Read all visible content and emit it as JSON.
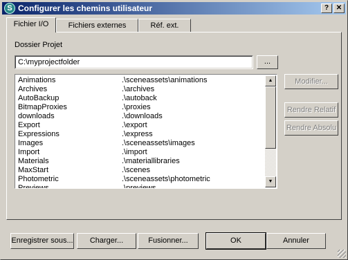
{
  "window": {
    "title": "Configurer les chemins utilisateur",
    "icon_letter": "S",
    "help_glyph": "?",
    "close_glyph": "✕"
  },
  "tabs": [
    {
      "label": "Fichier I/O",
      "active": true
    },
    {
      "label": "Fichiers externes",
      "active": false
    },
    {
      "label": "Réf. ext.",
      "active": false
    }
  ],
  "project": {
    "label": "Dossier Projet",
    "value": "C:\\myprojectfolder",
    "browse_label": "..."
  },
  "paths": [
    {
      "name": "Animations",
      "path": ".\\sceneassets\\animations"
    },
    {
      "name": "Archives",
      "path": ".\\archives"
    },
    {
      "name": "AutoBackup",
      "path": ".\\autoback"
    },
    {
      "name": "BitmapProxies",
      "path": ".\\proxies"
    },
    {
      "name": "downloads",
      "path": ".\\downloads"
    },
    {
      "name": "Export",
      "path": ".\\export"
    },
    {
      "name": "Expressions",
      "path": ".\\express"
    },
    {
      "name": "Images",
      "path": ".\\sceneassets\\images"
    },
    {
      "name": "Import",
      "path": ".\\import"
    },
    {
      "name": "Materials",
      "path": ".\\materiallibraries"
    },
    {
      "name": "MaxStart",
      "path": ".\\scenes"
    },
    {
      "name": "Photometric",
      "path": ".\\sceneassets\\photometric"
    },
    {
      "name": "Previews",
      "path": ".\\previews"
    }
  ],
  "side_buttons": {
    "modify": "Modifier...",
    "relative": "Rendre Relatif",
    "absolute": "Rendre Absolu"
  },
  "footer": {
    "save_as": "Enregistrer sous...",
    "load": "Charger...",
    "merge": "Fusionner...",
    "ok": "OK",
    "cancel": "Annuler"
  },
  "scrollbar": {
    "up_glyph": "▲",
    "down_glyph": "▼"
  }
}
